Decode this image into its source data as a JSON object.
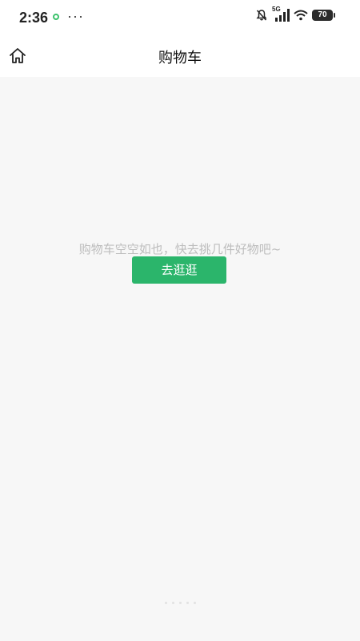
{
  "status_bar": {
    "time": "2:36",
    "network": "5G",
    "battery": "70"
  },
  "header": {
    "title": "购物车"
  },
  "cart": {
    "empty_message": "购物车空空如也，快去挑几件好物吧~",
    "go_shopping_label": "去逛逛"
  },
  "colors": {
    "accent": "#2bb56b",
    "empty_text": "#bdbdbd",
    "background": "#f7f7f7"
  },
  "icons": {
    "home": "home-icon",
    "mute": "bell-off-icon",
    "wifi": "wifi-icon"
  }
}
